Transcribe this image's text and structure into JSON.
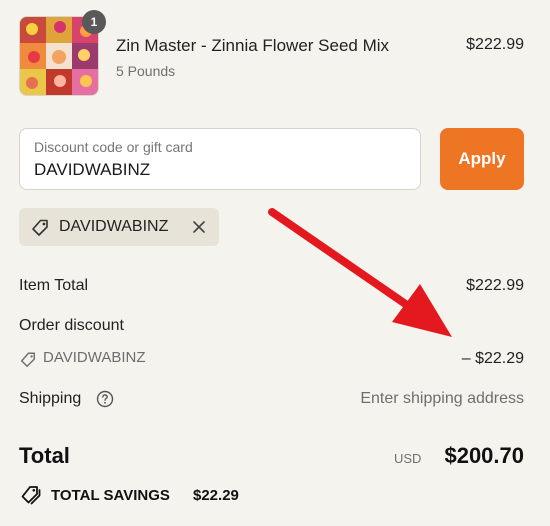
{
  "product": {
    "name": "Zin Master - Zinnia Flower Seed Mix",
    "variant": "5 Pounds",
    "price": "$222.99",
    "quantity": "1"
  },
  "discount": {
    "placeholder": "Discount code or gift card",
    "value": "DAVIDWABINZ",
    "apply_label": "Apply",
    "applied_code": "DAVIDWABINZ"
  },
  "summary": {
    "item_total_label": "Item Total",
    "item_total_value": "$222.99",
    "order_discount_label": "Order discount",
    "order_discount_code": "DAVIDWABINZ",
    "order_discount_value": "– $22.29",
    "shipping_label": "Shipping",
    "shipping_value": "Enter shipping address",
    "total_label": "Total",
    "currency": "USD",
    "total_value": "$200.70",
    "savings_label": "TOTAL SAVINGS",
    "savings_value": "$22.29"
  },
  "colors": {
    "accent": "#ee7524",
    "background": "#f5f3ee",
    "chip": "#e8e3d8",
    "annotation_arrow": "#e3191f"
  },
  "icons": {
    "tag": "tag-icon",
    "remove": "close-icon",
    "help": "question-circle-icon",
    "savings": "tags-icon"
  }
}
